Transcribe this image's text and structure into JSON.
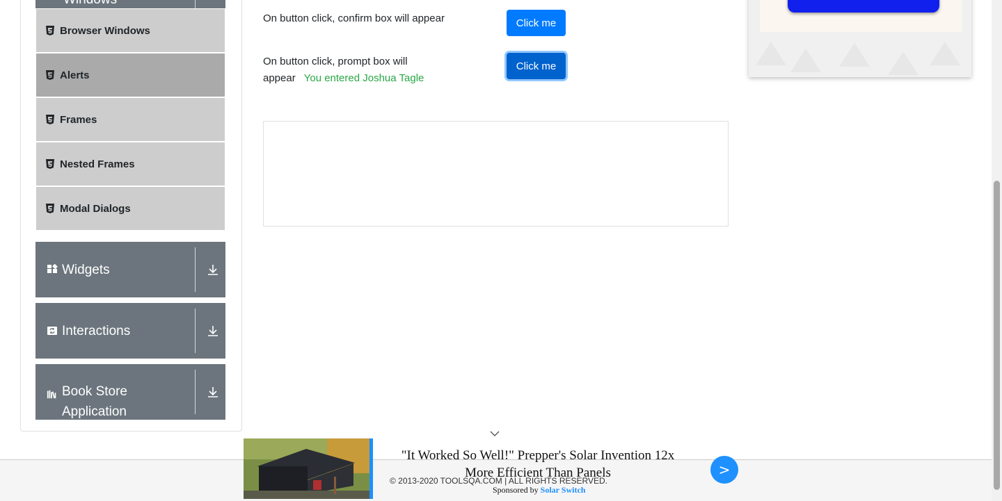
{
  "sidebar": {
    "top_group_label": "Windows",
    "items": [
      {
        "label": "Browser Windows",
        "active": false
      },
      {
        "label": "Alerts",
        "active": true
      },
      {
        "label": "Frames",
        "active": false
      },
      {
        "label": "Nested Frames",
        "active": false
      },
      {
        "label": "Modal Dialogs",
        "active": false
      }
    ],
    "groups": [
      {
        "label": "Widgets",
        "icon": "widgets-icon"
      },
      {
        "label": "Interactions",
        "icon": "interactions-icon"
      },
      {
        "label": "Book Store",
        "label_line2": "Application",
        "icon": "book-store-icon"
      }
    ]
  },
  "main": {
    "confirm_text": "On button click, confirm box will appear",
    "confirm_button": "Click me",
    "prompt_text_line1": "On button click, prompt box will",
    "prompt_text_line2": "appear",
    "prompt_result": "You entered Joshua Tagle",
    "prompt_button": "Click me"
  },
  "footer": {
    "copyright": "© 2013-2020 TOOLSQA.COM | ALL RIGHTS RESERVED."
  },
  "bottom_ad": {
    "headline": "\"It Worked So Well!\" Prepper's Solar Invention 12x More Efficient Than Panels",
    "sponsored_prefix": "Sponsored by",
    "sponsor_name": "Solar Switch",
    "go_label": ">"
  },
  "colors": {
    "primary": "#007bff",
    "success": "#28a745",
    "sidebar_group": "#6c757d",
    "sidebar_item": "#cdcdcd",
    "sidebar_item_active": "#aaaaaa",
    "ad_accent": "#1e90ff"
  }
}
